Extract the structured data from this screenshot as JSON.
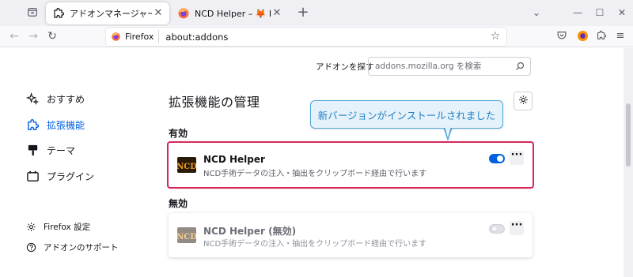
{
  "tabs": [
    {
      "label": "アドオンマネージャー",
      "active": true,
      "icon": "puzzle-icon"
    },
    {
      "label": "NCD Helper – 🦊 Firefox (ja) 向け",
      "active": false,
      "icon": "firefox-icon"
    }
  ],
  "navbar": {
    "identity_label": "Firefox",
    "url": "about:addons"
  },
  "search": {
    "label": "アドオンを探す",
    "placeholder": "addons.mozilla.org を検索"
  },
  "sidebar": {
    "items": [
      {
        "label": "おすすめ",
        "icon": "sparkle-icon",
        "selected": false
      },
      {
        "label": "拡張機能",
        "icon": "puzzle-icon",
        "selected": true
      },
      {
        "label": "テーマ",
        "icon": "paintbrush-icon",
        "selected": false
      },
      {
        "label": "プラグイン",
        "icon": "plugin-icon",
        "selected": false
      }
    ],
    "footer": [
      {
        "label": "Firefox 設定",
        "icon": "gear-icon"
      },
      {
        "label": "アドオンのサポート",
        "icon": "help-icon"
      }
    ]
  },
  "main": {
    "heading": "拡張機能の管理",
    "enabled_section": "有効",
    "disabled_section": "無効",
    "enabled_addon": {
      "name": "NCD Helper",
      "description": "NCD手術データの注入・抽出をクリップボード経由で行います",
      "enabled": true
    },
    "disabled_addon": {
      "name": "NCD Helper (無効)",
      "description": "NCD手術データの注入・抽出をクリップボード経由で行います",
      "enabled": false
    }
  },
  "callout": {
    "text": "新バージョンがインストールされました"
  },
  "colors": {
    "accent": "#0061e0",
    "highlight_border": "#d8285a",
    "callout_border": "#4fa6d8",
    "callout_bg": "#e6f2fb"
  }
}
